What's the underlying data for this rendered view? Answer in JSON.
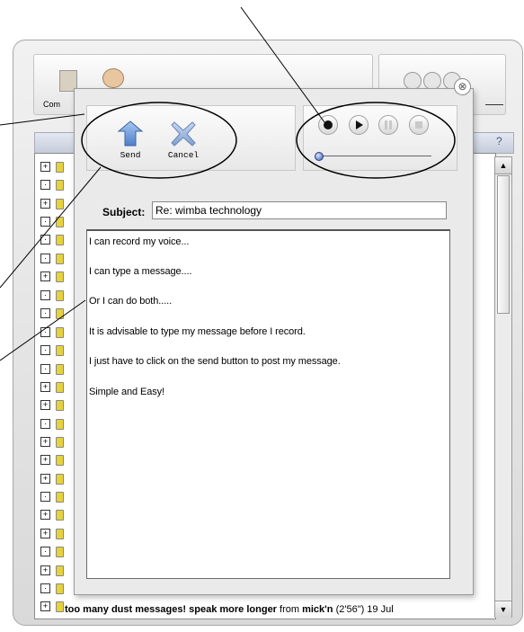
{
  "toolbar": {
    "compose_label_partial": "Com"
  },
  "dialog": {
    "close_glyph": "⊗",
    "actions": {
      "send_label": "Send",
      "send_icon": "send-arrow-icon",
      "cancel_label": "Cancel",
      "cancel_icon": "cancel-x-icon"
    },
    "recorder": {
      "buttons": [
        "record",
        "play",
        "pause",
        "stop"
      ],
      "record_icon": "record-icon",
      "play_icon": "play-icon",
      "pause_icon": "pause-icon",
      "stop_icon": "stop-icon",
      "volume_level": 0
    },
    "subject": {
      "label": "Subject:",
      "value": "Re: wimba technology"
    },
    "message_lines": [
      "I can record my voice...",
      "I can type a message....",
      "Or I can do both.....",
      "It is advisable to type my message before I record.",
      "I just have to click on the send button to post my message.",
      "Simple and Easy!"
    ]
  },
  "background_list": {
    "last_row": {
      "title": "too many dust messages! speak more longer",
      "from_label": " from ",
      "author": "mick'n",
      "meta": " (2'56\") 19 Jul"
    }
  },
  "scrollbar": {
    "up_glyph": "▲",
    "down_glyph": "▼"
  },
  "colors": {
    "annotation_stroke": "#000000",
    "send_icon_blue": "#5b8fd6",
    "cancel_icon_blue": "#8aaad8",
    "slider_knob": "#3a5ab0"
  }
}
